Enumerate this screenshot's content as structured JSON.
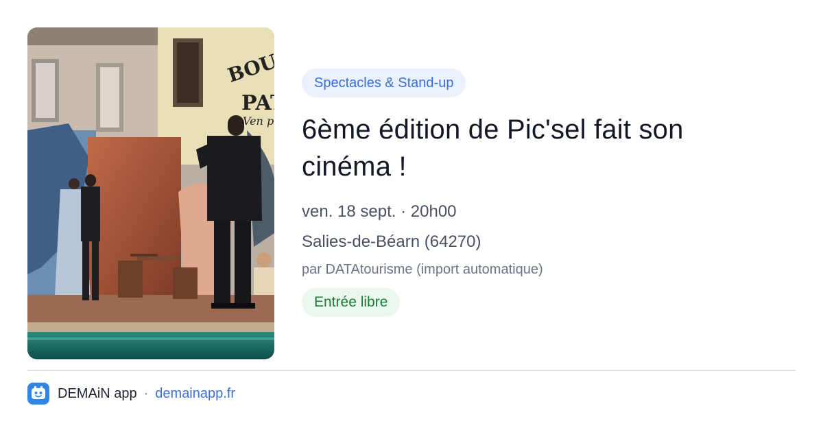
{
  "event": {
    "category": "Spectacles & Stand-up",
    "title": "6ème édition de Pic'sel fait son cinéma !",
    "date": "ven. 18 sept.",
    "separator": "·",
    "time": "20h00",
    "location": "Salies-de-Béarn (64270)",
    "organizer": "par DATAtourisme (import automatique)",
    "price": "Entrée libre",
    "image_sign_text": [
      "BOU",
      "PAT",
      "Ven p"
    ]
  },
  "footer": {
    "logo_icon": "demain-app-logo-icon",
    "app_name": "DEMAiN app",
    "separator": "·",
    "link": "demainapp.fr"
  },
  "colors": {
    "accent_blue": "#3b6fd8",
    "category_bg": "#eaf1fd",
    "price_green": "#1f7a3a",
    "price_bg": "#e9f7ec"
  }
}
